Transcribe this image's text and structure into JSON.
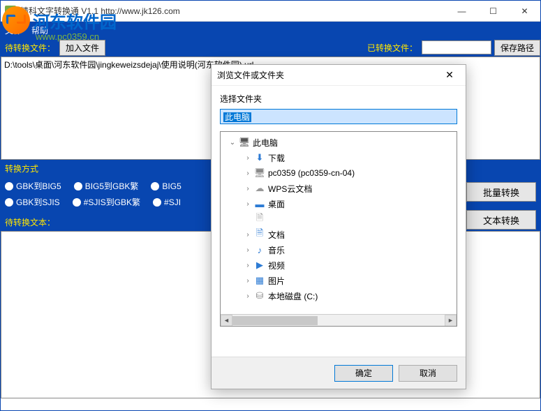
{
  "window": {
    "title": "精科文字转换通  V1.1    http://www.jk126.com",
    "min": "—",
    "max": "☐",
    "close": "✕"
  },
  "watermark": {
    "site_name": "河东软件园",
    "url": "www.pc0359.cn"
  },
  "menu": {
    "file": "文件",
    "help": "帮助"
  },
  "toolbar": {
    "pending_label": "待转换文件：",
    "add_file": "加入文件",
    "converted_label": "已转换文件：",
    "save_path": "保存路径"
  },
  "file_entry": "D:\\tools\\桌面\\河东软件园\\jingkeweizsdejaj\\使用说明(河东软件园).url",
  "convert_mode": {
    "header": "转换方式",
    "row1": [
      "GBK到BIG5",
      "BIG5到GBK繁",
      "BIG5"
    ],
    "row2": [
      "GBK到SJIS",
      "#SJIS到GBK繁",
      "#SJI"
    ]
  },
  "side": {
    "batch": "批量转换",
    "text": "文本转换"
  },
  "pending_text_header": "待转换文本：",
  "dialog": {
    "title": "浏览文件或文件夹",
    "close": "✕",
    "label": "选择文件夹",
    "input_value": "此电脑",
    "ok": "确定",
    "cancel": "取消",
    "tree": [
      {
        "depth": 1,
        "expander": "⌄",
        "icon": "ico-pc",
        "glyph": "🖥",
        "label": "此电脑"
      },
      {
        "depth": 2,
        "expander": "›",
        "icon": "ico-download",
        "glyph": "⬇",
        "label": "下载"
      },
      {
        "depth": 2,
        "expander": "›",
        "icon": "ico-pc2",
        "glyph": "🖥",
        "label": "pc0359 (pc0359-cn-04)"
      },
      {
        "depth": 2,
        "expander": "›",
        "icon": "ico-cloud",
        "glyph": "☁",
        "label": "WPS云文档"
      },
      {
        "depth": 2,
        "expander": "›",
        "icon": "ico-desktop",
        "glyph": "▬",
        "label": "桌面"
      },
      {
        "depth": 2,
        "expander": "",
        "icon": "ico-doc",
        "glyph": "🗎",
        "label": ""
      },
      {
        "depth": 2,
        "expander": "›",
        "icon": "ico-docs",
        "glyph": "🗎",
        "label": "文档"
      },
      {
        "depth": 2,
        "expander": "›",
        "icon": "ico-music",
        "glyph": "♪",
        "label": "音乐"
      },
      {
        "depth": 2,
        "expander": "›",
        "icon": "ico-video",
        "glyph": "▶",
        "label": "视频"
      },
      {
        "depth": 2,
        "expander": "›",
        "icon": "ico-pics",
        "glyph": "▦",
        "label": "图片"
      },
      {
        "depth": 2,
        "expander": "›",
        "icon": "ico-disk",
        "glyph": "⛁",
        "label": "本地磁盘 (C:)"
      }
    ]
  }
}
